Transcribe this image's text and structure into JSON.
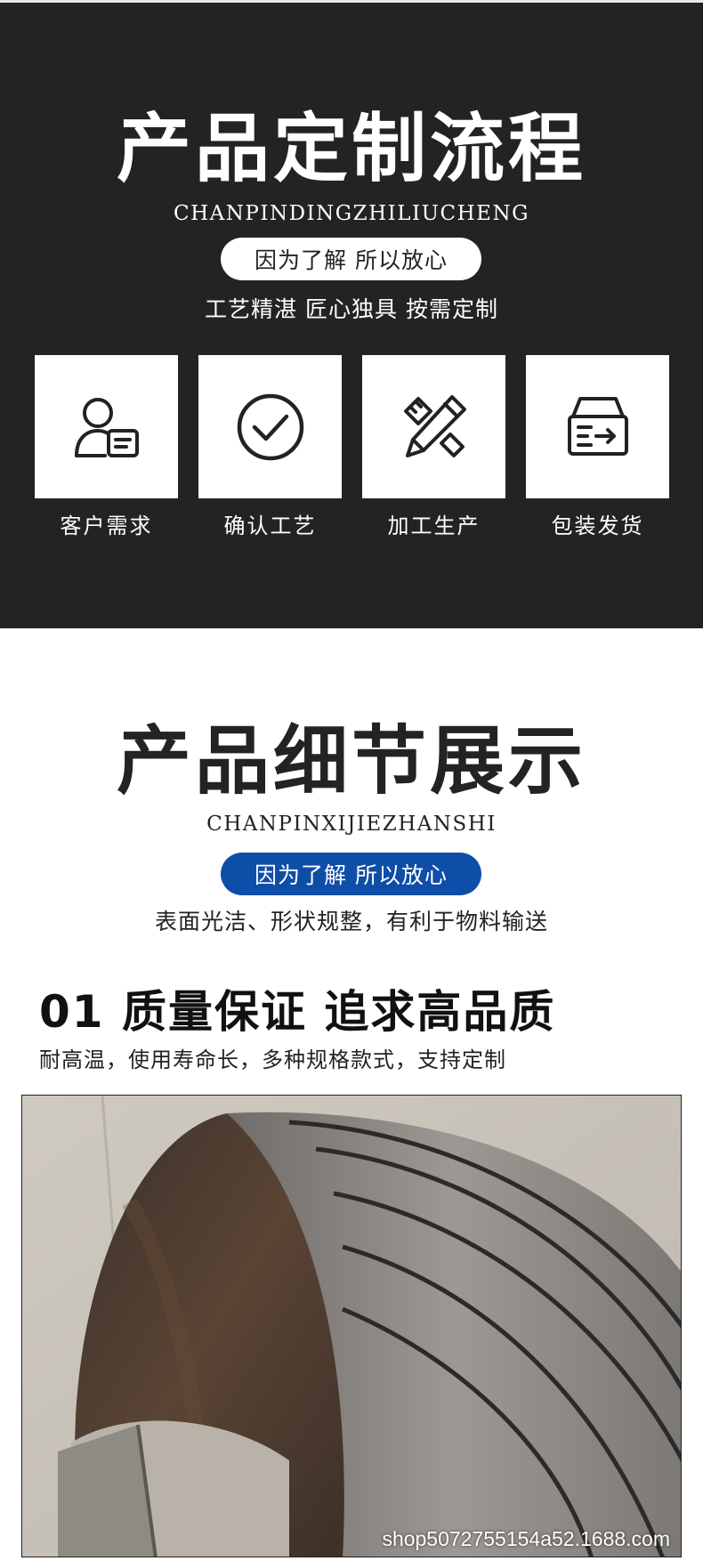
{
  "process": {
    "title": "产品定制流程",
    "pinyin": "CHANPINDINGZHILIUCHENG",
    "pill": "因为了解 所以放心",
    "subtitle": "工艺精湛 匠心独具 按需定制",
    "steps": [
      {
        "label": "客户需求",
        "icon": "user-profile-icon"
      },
      {
        "label": "确认工艺",
        "icon": "check-circle-icon"
      },
      {
        "label": "加工生产",
        "icon": "pencil-ruler-icon"
      },
      {
        "label": "包装发货",
        "icon": "shipping-box-icon"
      }
    ]
  },
  "details": {
    "title": "产品细节展示",
    "pinyin": "CHANPINXIJIEZHANSHI",
    "pill": "因为了解 所以放心",
    "subtitle": "表面光洁、形状规整，有利于物料输送",
    "section_heading": "01 质量保证 追求高品质",
    "section_text": "耐高温，使用寿命长，多种规格款式，支持定制",
    "photo_watermark": "shop5072755154a52.1688.com"
  },
  "colors": {
    "dark_bg": "#232323",
    "accent_blue": "#0f4ea8",
    "text_dark": "#222222"
  }
}
